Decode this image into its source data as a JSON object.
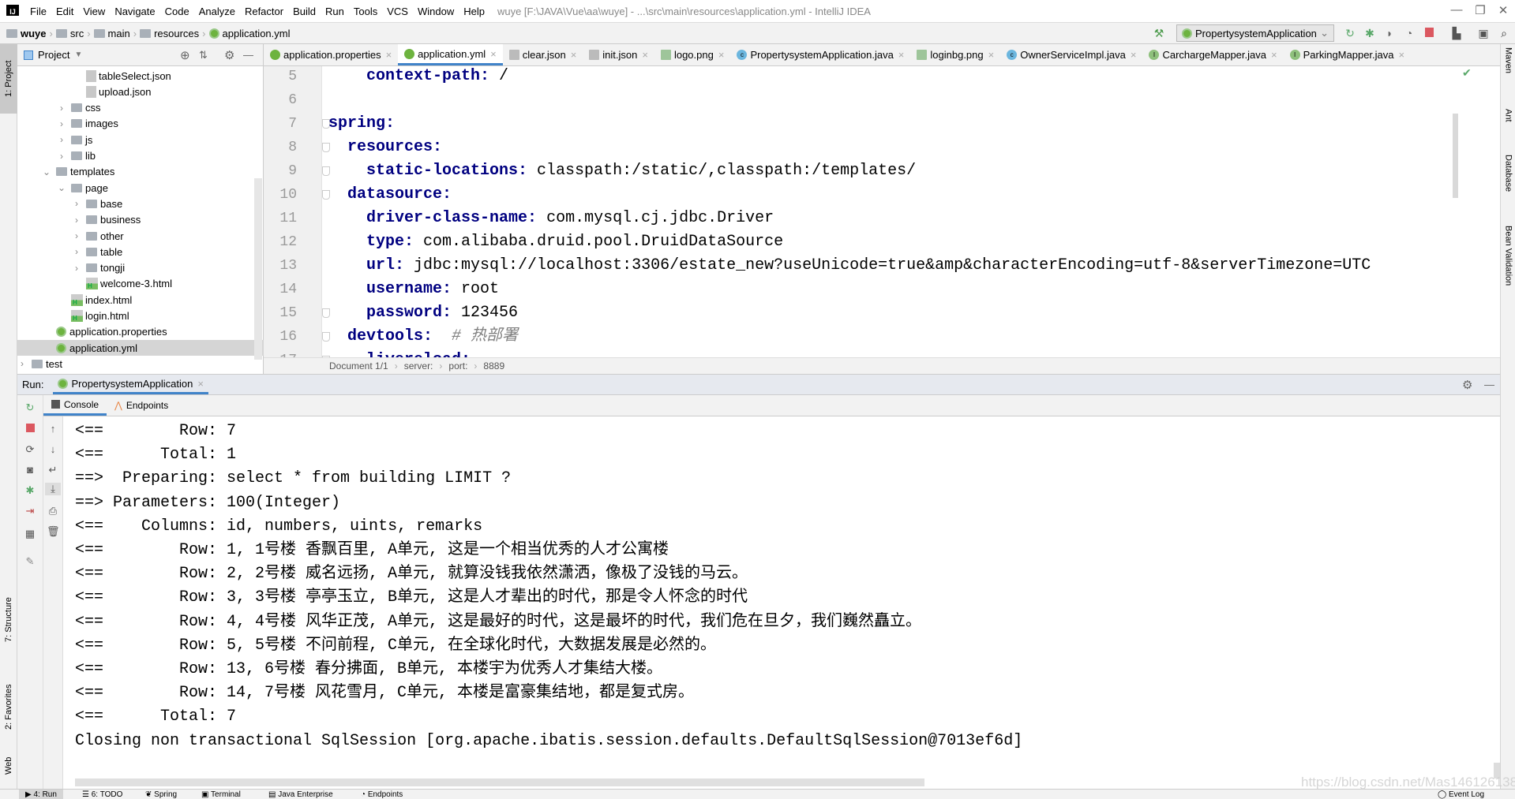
{
  "titlebar": {
    "menu": [
      "File",
      "Edit",
      "View",
      "Navigate",
      "Code",
      "Analyze",
      "Refactor",
      "Build",
      "Run",
      "Tools",
      "VCS",
      "Window",
      "Help"
    ],
    "window_title": "wuye [F:\\JAVA\\Vue\\aa\\wuye] - ...\\src\\main\\resources\\application.yml - IntelliJ IDEA",
    "logo": "IJ"
  },
  "navbar": {
    "crumbs": [
      "wuye",
      "src",
      "main",
      "resources",
      "application.yml"
    ],
    "run_config": "PropertysystemApplication"
  },
  "left_stripe": {
    "tabs": [
      "1: Project",
      "7: Structure",
      "2: Favorites",
      "Web"
    ]
  },
  "right_stripe": {
    "tabs": [
      "Maven",
      "Ant",
      "Database",
      "Bean Validation"
    ]
  },
  "project": {
    "title": "Project",
    "tree": [
      {
        "label": "tableSelect.json",
        "depth": 5,
        "type": "json",
        "arrow": ""
      },
      {
        "label": "upload.json",
        "depth": 5,
        "type": "json",
        "arrow": ""
      },
      {
        "label": "css",
        "depth": 4,
        "type": "folder",
        "arrow": "collapsed"
      },
      {
        "label": "images",
        "depth": 4,
        "type": "folder",
        "arrow": "collapsed"
      },
      {
        "label": "js",
        "depth": 4,
        "type": "folder",
        "arrow": "collapsed"
      },
      {
        "label": "lib",
        "depth": 4,
        "type": "folder",
        "arrow": "collapsed"
      },
      {
        "label": "templates",
        "depth": 3,
        "type": "folder",
        "arrow": "expanded"
      },
      {
        "label": "page",
        "depth": 4,
        "type": "folder",
        "arrow": "expanded"
      },
      {
        "label": "base",
        "depth": 5,
        "type": "folder",
        "arrow": "collapsed"
      },
      {
        "label": "business",
        "depth": 5,
        "type": "folder",
        "arrow": "collapsed"
      },
      {
        "label": "other",
        "depth": 5,
        "type": "folder",
        "arrow": "collapsed"
      },
      {
        "label": "table",
        "depth": 5,
        "type": "folder",
        "arrow": "collapsed"
      },
      {
        "label": "tongji",
        "depth": 5,
        "type": "folder",
        "arrow": "collapsed"
      },
      {
        "label": "welcome-3.html",
        "depth": 5,
        "type": "html",
        "arrow": ""
      },
      {
        "label": "index.html",
        "depth": 4,
        "type": "html",
        "arrow": ""
      },
      {
        "label": "login.html",
        "depth": 4,
        "type": "html",
        "arrow": ""
      },
      {
        "label": "application.properties",
        "depth": 3,
        "type": "spring",
        "arrow": ""
      },
      {
        "label": "application.yml",
        "depth": 3,
        "type": "spring",
        "arrow": "",
        "selected": true
      },
      {
        "label": "test",
        "depth": 1,
        "type": "folder",
        "arrow": "collapsed"
      }
    ]
  },
  "editor": {
    "tabs": [
      {
        "label": "application.properties",
        "icon": "spring"
      },
      {
        "label": "application.yml",
        "icon": "spring",
        "active": true
      },
      {
        "label": "clear.json",
        "icon": "json"
      },
      {
        "label": "init.json",
        "icon": "json"
      },
      {
        "label": "logo.png",
        "icon": "image"
      },
      {
        "label": "PropertysystemApplication.java",
        "icon": "class"
      },
      {
        "label": "loginbg.png",
        "icon": "image"
      },
      {
        "label": "OwnerServiceImpl.java",
        "icon": "class"
      },
      {
        "label": "CarchargeMapper.java",
        "icon": "interface"
      },
      {
        "label": "ParkingMapper.java",
        "icon": "interface"
      }
    ],
    "lines": [
      {
        "n": "5",
        "indent": 2,
        "key": "context-path",
        "value": " /",
        "fold": false
      },
      {
        "n": "6",
        "indent": 0,
        "key": "",
        "value": "",
        "fold": false
      },
      {
        "n": "7",
        "indent": 0,
        "key": "spring",
        "value": "",
        "fold": true
      },
      {
        "n": "8",
        "indent": 1,
        "key": "resources",
        "value": "",
        "fold": true
      },
      {
        "n": "9",
        "indent": 2,
        "key": "static-locations",
        "value": " classpath:/static/,classpath:/templates/",
        "fold": true
      },
      {
        "n": "10",
        "indent": 1,
        "key": "datasource",
        "value": "",
        "fold": true
      },
      {
        "n": "11",
        "indent": 2,
        "key": "driver-class-name",
        "value": " com.mysql.cj.jdbc.Driver",
        "fold": false
      },
      {
        "n": "12",
        "indent": 2,
        "key": "type",
        "value": " com.alibaba.druid.pool.DruidDataSource",
        "fold": false
      },
      {
        "n": "13",
        "indent": 2,
        "key": "url",
        "value": " jdbc:mysql://localhost:3306/estate_new?useUnicode=true&amp&characterEncoding=utf-8&serverTimezone=UTC",
        "fold": false
      },
      {
        "n": "14",
        "indent": 2,
        "key": "username",
        "value": " root",
        "fold": false
      },
      {
        "n": "15",
        "indent": 2,
        "key": "password",
        "value": " 123456",
        "fold": true
      },
      {
        "n": "16",
        "indent": 1,
        "key": "devtools",
        "value": "",
        "comment": "  # 热部署",
        "fold": true
      },
      {
        "n": "17",
        "indent": 2,
        "key": "livereload",
        "value": "",
        "fold": true
      }
    ],
    "breadcrumb": [
      "Document 1/1",
      "server:",
      "port:",
      "8889"
    ]
  },
  "run": {
    "label": "Run:",
    "tab": "PropertysystemApplication",
    "subtabs": [
      "Console",
      "Endpoints"
    ],
    "console": [
      "<==        Row: 7",
      "<==      Total: 1",
      "==>  Preparing: select * from building LIMIT ?",
      "==> Parameters: 100(Integer)",
      "<==    Columns: id, numbers, uints, remarks",
      "<==        Row: 1, 1号楼 香飘百里, A单元, 这是一个相当优秀的人才公寓楼",
      "<==        Row: 2, 2号楼 威名远扬, A单元, 就算没钱我依然潇洒，像极了没钱的马云。",
      "<==        Row: 3, 3号楼 亭亭玉立, B单元, 这是人才辈出的时代，那是令人怀念的时代",
      "<==        Row: 4, 4号楼 风华正茂, A单元, 这是最好的时代，这是最坏的时代，我们危在旦夕，我们巍然矗立。",
      "<==        Row: 5, 5号楼 不问前程, C单元, 在全球化时代，大数据发展是必然的。",
      "<==        Row: 13, 6号楼 春分拂面, B单元, 本楼宇为优秀人才集结大楼。",
      "<==        Row: 14, 7号楼 风花雪月, C单元, 本楼是富豪集结地，都是复式房。",
      "<==      Total: 7",
      "Closing non transactional SqlSession [org.apache.ibatis.session.defaults.DefaultSqlSession@7013ef6d]"
    ]
  },
  "statusbar": {
    "items": [
      "4: Run",
      "6: TODO",
      "Spring",
      "Terminal",
      "Java Enterprise",
      "Endpoints"
    ],
    "event_log": "Event Log"
  },
  "watermark": "https://blog.csdn.net/Mas1461261388",
  "colors": {
    "accent": "#4083c9",
    "yaml_key": "#000080",
    "comment": "#808080",
    "stop": "#db5860",
    "run_green": "#59a869"
  }
}
